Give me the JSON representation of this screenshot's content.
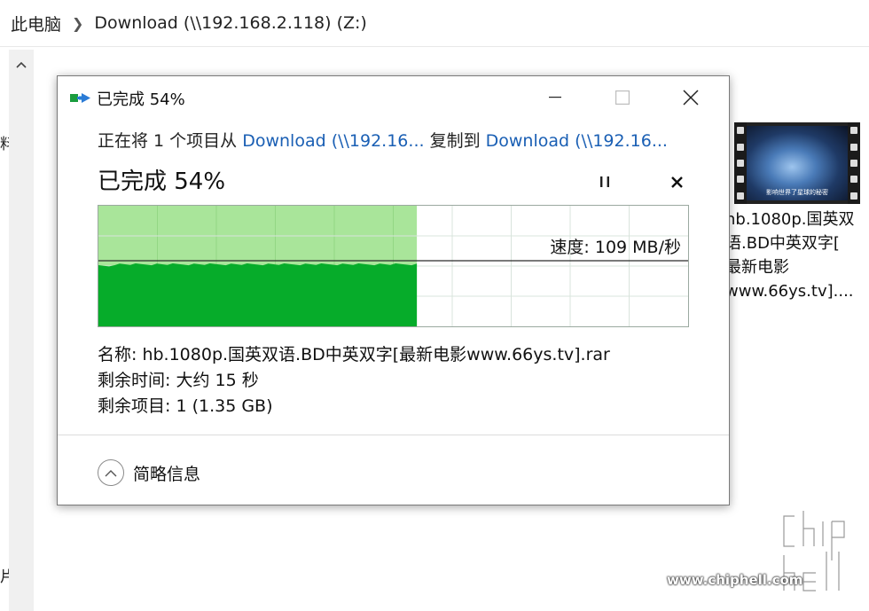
{
  "explorer": {
    "breadcrumb": [
      "此电脑",
      "Download (\\\\192.168.2.118) (Z:)"
    ],
    "edge_chars": [
      "料",
      "片"
    ],
    "file": {
      "thumbnail_caption": "影响世界了星球的秘密",
      "name_lines": [
        "hb.1080p.国英双",
        "语.BD中英双字[",
        "最新电影",
        "www.66ys.tv]...."
      ]
    }
  },
  "dialog": {
    "title": "已完成 54%",
    "copy_prefix": "正在将 1 个项目从",
    "source": "Download (\\\\192.16...",
    "copy_mid": "复制到",
    "destination": "Download (\\\\192.16...",
    "status": "已完成 54%",
    "progress_percent": 54,
    "speed_label": "速度: 109 MB/秒",
    "details": [
      {
        "label": "名称:",
        "value": "hb.1080p.国英双语.BD中英双字[最新电影www.66ys.tv].rar"
      },
      {
        "label": "剩余时间:",
        "value": "大约 15 秒"
      },
      {
        "label": "剩余项目:",
        "value": "1 (1.35 GB)"
      }
    ],
    "fewer_details": "简略信息"
  },
  "watermark": {
    "url": "www.chiphell.com"
  },
  "colors": {
    "progress_light": "#a9e59a",
    "progress_dark": "#06ac2a",
    "link": "#1a5fb4"
  }
}
